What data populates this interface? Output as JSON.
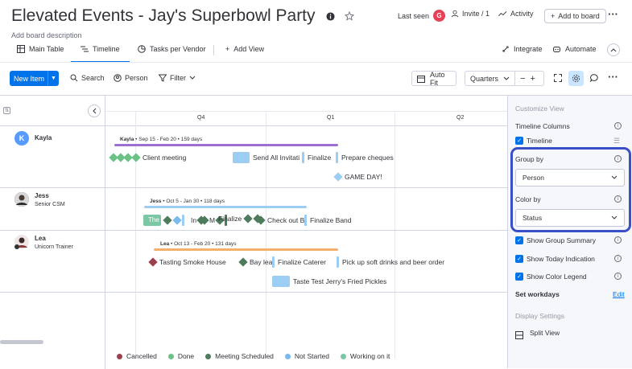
{
  "board": {
    "title": "Elevated Events - Jay's Superbowl Party",
    "description": "Add board description"
  },
  "topbar": {
    "last_seen": "Last seen",
    "last_seen_avatar": "G",
    "invite": "Invite / 1",
    "activity": "Activity",
    "add_to_board": "Add to board"
  },
  "tabs": [
    {
      "label": "Main Table",
      "icon": "table-icon"
    },
    {
      "label": "Timeline",
      "icon": "timeline-icon",
      "active": true
    },
    {
      "label": "Tasks per Vendor",
      "icon": "chart-icon"
    },
    {
      "label": "Add View",
      "icon": "plus-icon"
    }
  ],
  "tab_actions": {
    "integrate": "Integrate",
    "automate": "Automate"
  },
  "toolbar": {
    "new_item": "New Item",
    "search": "Search",
    "person": "Person",
    "filter": "Filter",
    "auto_fit": "Auto Fit",
    "zoom_scale": "Quarters"
  },
  "timeline": {
    "quarters": [
      "Q4",
      "Q1",
      "Q2"
    ],
    "groups": [
      {
        "name": "Kayla",
        "subtitle": "",
        "initial": "K",
        "summary_name": "Kayla",
        "summary_rest": "• Sep 15 - Feb 20 • 159 days",
        "items": [
          "C",
          "Client meeting",
          "Send All Invitati",
          "Finalize",
          "Prepare cheques",
          "GAME DAY!"
        ]
      },
      {
        "name": "Jess",
        "subtitle": "Senior CSM",
        "summary_name": "Jess",
        "summary_rest": "• Oct 5 - Jan 30 • 118 days",
        "items": [
          "The",
          "In",
          "M",
          "Finalize",
          "Check out B",
          "Finalize Band"
        ]
      },
      {
        "name": "Lea",
        "subtitle": "Unicorn Trainer",
        "summary_name": "Lea",
        "summary_rest": "• Oct 13 - Feb 20 • 131 days",
        "items": [
          "Tasting Smoke House",
          "Bay lea",
          "Finalize Caterer",
          "Pick up soft drinks and beer order",
          "Taste Test Jerry's Fried Pickles"
        ]
      }
    ]
  },
  "legend": [
    {
      "label": "Cancelled",
      "color": "#9d3f4f"
    },
    {
      "label": "Done",
      "color": "#6bc186"
    },
    {
      "label": "Meeting Scheduled",
      "color": "#4d7b5b"
    },
    {
      "label": "Not Started",
      "color": "#79b9ee"
    },
    {
      "label": "Working on it",
      "color": "#79c7a4"
    }
  ],
  "panel": {
    "customize_view": "Customize View",
    "timeline_columns": "Timeline Columns",
    "timeline_check": "Timeline",
    "group_by_label": "Group by",
    "group_by_value": "Person",
    "color_by_label": "Color by",
    "color_by_value": "Status",
    "show_group_summary": "Show Group Summary",
    "show_today": "Show Today Indication",
    "show_color_legend": "Show Color Legend",
    "set_workdays": "Set workdays",
    "edit": "Edit",
    "display_settings": "Display Settings",
    "split_view": "Split View"
  },
  "colors": {
    "accent": "#0073ea",
    "highlight": "#3b4fc7"
  }
}
